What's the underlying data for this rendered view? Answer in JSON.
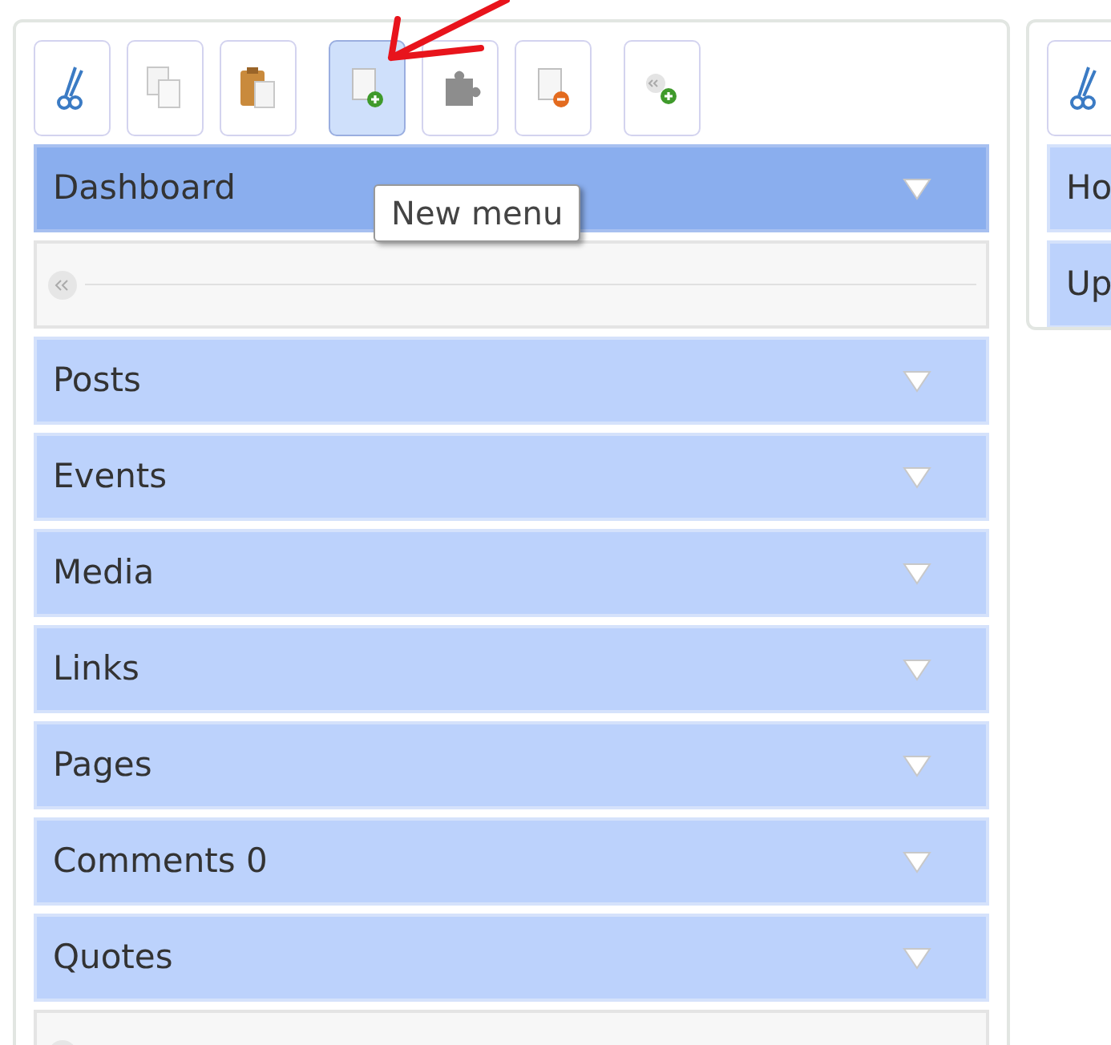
{
  "left_panel": {
    "toolbar": [
      {
        "kind": "cut",
        "selected": false
      },
      {
        "kind": "copy",
        "selected": false
      },
      {
        "kind": "paste",
        "selected": false
      },
      {
        "kind": "new",
        "selected": true
      },
      {
        "kind": "plugin",
        "selected": false
      },
      {
        "kind": "remove",
        "selected": false
      },
      {
        "kind": "separator-add",
        "selected": false
      }
    ],
    "tooltip": "New menu",
    "menu": [
      {
        "kind": "item",
        "label": "Dashboard",
        "selected": true
      },
      {
        "kind": "separator"
      },
      {
        "kind": "item",
        "label": "Posts",
        "selected": false
      },
      {
        "kind": "item",
        "label": "Events",
        "selected": false
      },
      {
        "kind": "item",
        "label": "Media",
        "selected": false
      },
      {
        "kind": "item",
        "label": "Links",
        "selected": false
      },
      {
        "kind": "item",
        "label": "Pages",
        "selected": false
      },
      {
        "kind": "item",
        "label": "Comments 0",
        "selected": false
      },
      {
        "kind": "item",
        "label": "Quotes",
        "selected": false
      },
      {
        "kind": "separator"
      }
    ]
  },
  "right_panel": {
    "toolbar": [
      {
        "kind": "cut",
        "selected": false
      }
    ],
    "menu": [
      {
        "kind": "item",
        "label": "Ho",
        "selected": false
      },
      {
        "kind": "item",
        "label": "Up",
        "selected": false
      }
    ]
  }
}
